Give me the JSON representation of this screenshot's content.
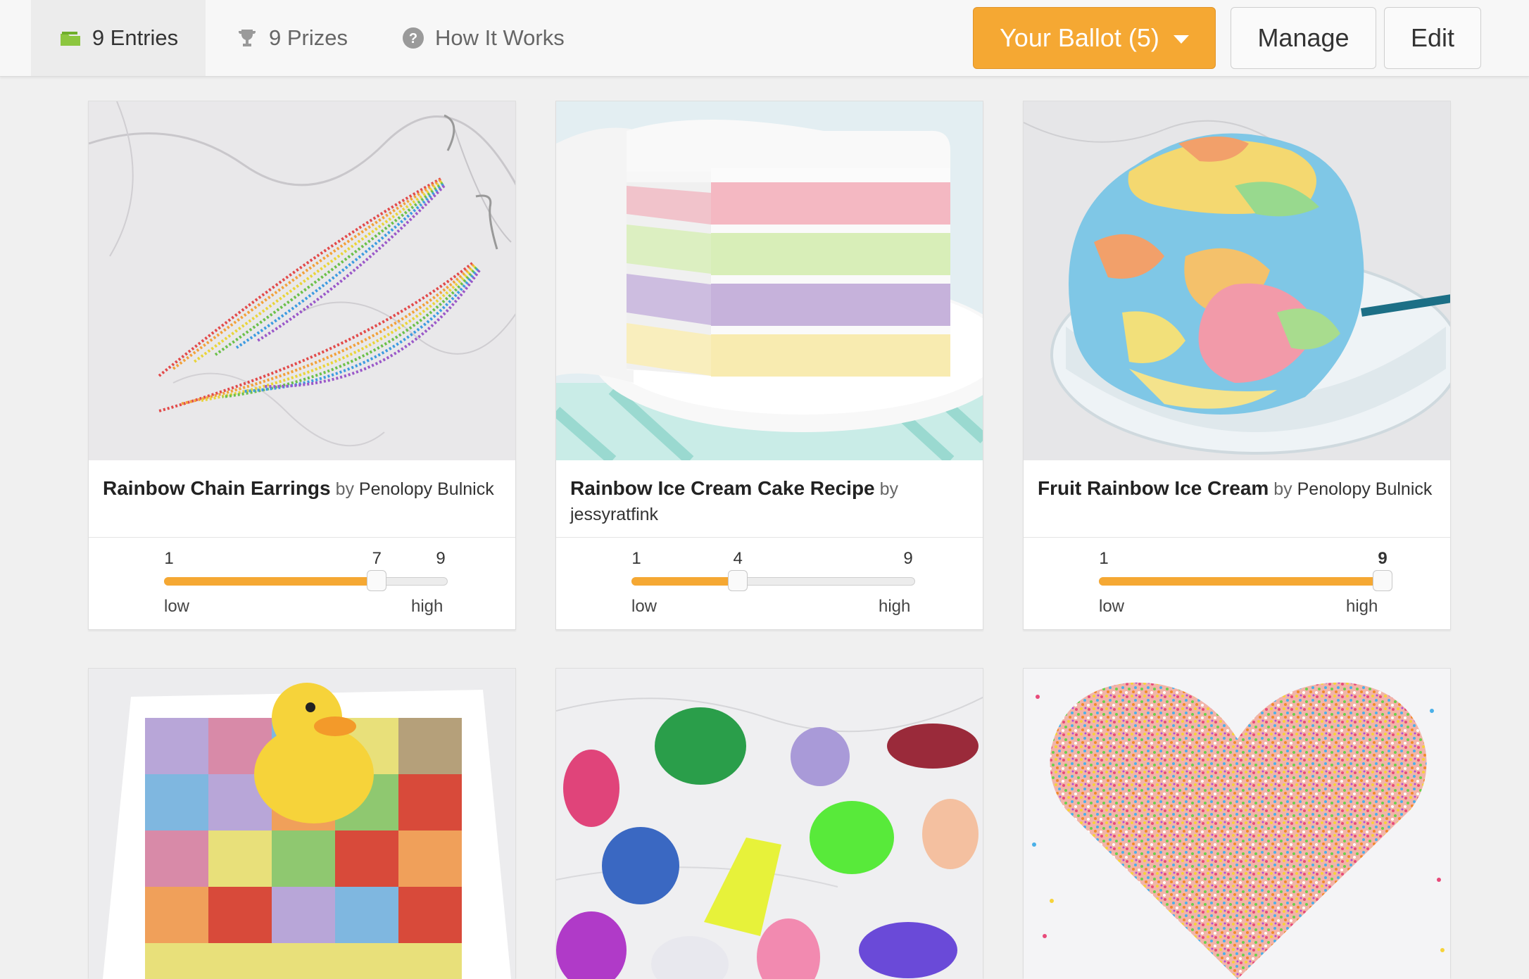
{
  "nav": {
    "tabs": [
      {
        "label": "9 Entries",
        "icon": "entries-folder-icon",
        "active": true
      },
      {
        "label": "9 Prizes",
        "icon": "trophy-icon",
        "active": false
      },
      {
        "label": "How It Works",
        "icon": "question-circle-icon",
        "active": false
      }
    ],
    "ballot_label": "Your Ballot (5)",
    "manage_label": "Manage",
    "edit_label": "Edit"
  },
  "colors": {
    "accent": "#f5a833",
    "entries_icon": "#8cc63f"
  },
  "scale": {
    "min": 1,
    "max": 9,
    "min_label": "1",
    "max_label": "9",
    "low_label": "low",
    "high_label": "high"
  },
  "entries": [
    {
      "title": "Rainbow Chain Earrings",
      "by": "by",
      "author": "Penolopy Bulnick",
      "rating": 7,
      "rating_label": "7",
      "image": "rainbow-earrings-photo"
    },
    {
      "title": "Rainbow Ice Cream Cake Recipe",
      "by": "by",
      "author": "jessyratfink",
      "rating": 4,
      "rating_label": "4",
      "image": "ice-cream-cake-photo"
    },
    {
      "title": "Fruit Rainbow Ice Cream",
      "by": "by",
      "author": "Penolopy Bulnick",
      "rating": 9,
      "rating_label": "9",
      "image": "rainbow-ice-cream-photo"
    },
    {
      "image": "crochet-square-duck-photo"
    },
    {
      "image": "crystal-gems-photo"
    },
    {
      "image": "sprinkle-heart-cake-photo"
    }
  ]
}
